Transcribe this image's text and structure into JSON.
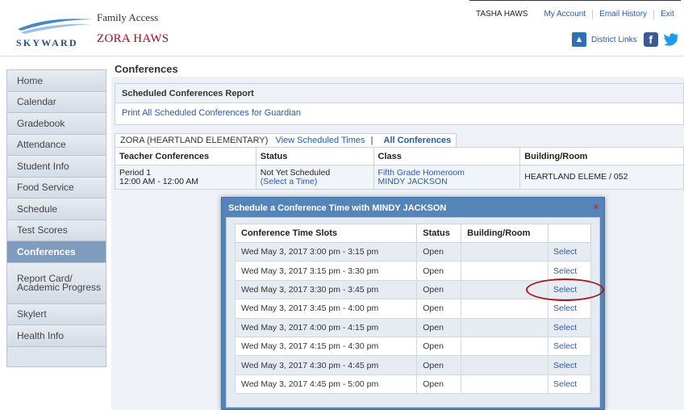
{
  "header": {
    "app_title": "Family Access",
    "logo_text": "SKYWARD",
    "student_name": "ZORA HAWS",
    "user_name": "TASHA HAWS",
    "my_account": "My Account",
    "email_history": "Email History",
    "exit": "Exit",
    "district_links": "District Links"
  },
  "sidebar": {
    "items": [
      {
        "label": "Home"
      },
      {
        "label": "Calendar"
      },
      {
        "label": "Gradebook"
      },
      {
        "label": "Attendance"
      },
      {
        "label": "Student Info"
      },
      {
        "label": "Food Service"
      },
      {
        "label": "Schedule"
      },
      {
        "label": "Test Scores"
      },
      {
        "label": "Conferences",
        "active": true
      },
      {
        "label": "Report Card/ Academic Progress"
      },
      {
        "label": "Skylert"
      },
      {
        "label": "Health Info"
      }
    ]
  },
  "main": {
    "page_title": "Conferences",
    "report_title": "Scheduled Conferences Report",
    "report_link": "Print All Scheduled Conferences for Guardian",
    "tabs": {
      "school": "ZORA (HEARTLAND ELEMENTARY)",
      "view_times": "View Scheduled Times",
      "separator": "|",
      "all_conferences": "All Conferences"
    },
    "table": {
      "headers": [
        "Teacher Conferences",
        "Status",
        "Class",
        "Building/Room"
      ],
      "row": {
        "period": "Period 1",
        "time": "12:00 AM - 12:00 AM",
        "status": "Not Yet Scheduled",
        "select_time": "(Select a Time)",
        "class_name": "Fifth Grade Homeroom",
        "teacher": "MINDY JACKSON",
        "building": "HEARTLAND ELEME / 052"
      }
    }
  },
  "modal": {
    "title": "Schedule a Conference Time with MINDY JACKSON",
    "close": "×",
    "headers": [
      "Conference Time Slots",
      "Status",
      "Building/Room",
      ""
    ],
    "slots": [
      {
        "time": "Wed May 3, 2017 3:00 pm - 3:15 pm",
        "status": "Open",
        "room": "",
        "action": "Select"
      },
      {
        "time": "Wed May 3, 2017 3:15 pm - 3:30 pm",
        "status": "Open",
        "room": "",
        "action": "Select"
      },
      {
        "time": "Wed May 3, 2017 3:30 pm - 3:45 pm",
        "status": "Open",
        "room": "",
        "action": "Select"
      },
      {
        "time": "Wed May 3, 2017 3:45 pm - 4:00 pm",
        "status": "Open",
        "room": "",
        "action": "Select"
      },
      {
        "time": "Wed May 3, 2017 4:00 pm - 4:15 pm",
        "status": "Open",
        "room": "",
        "action": "Select"
      },
      {
        "time": "Wed May 3, 2017 4:15 pm - 4:30 pm",
        "status": "Open",
        "room": "",
        "action": "Select"
      },
      {
        "time": "Wed May 3, 2017 4:30 pm - 4:45 pm",
        "status": "Open",
        "room": "",
        "action": "Select"
      },
      {
        "time": "Wed May 3, 2017 4:45 pm - 5:00 pm",
        "status": "Open",
        "room": "",
        "action": "Select"
      }
    ]
  },
  "colors": {
    "link": "#2a5aa7",
    "student_name": "#a30c1b",
    "modal_header": "#5585b8",
    "active_sidebar": "#7f9bbd",
    "highlight": "#a51c1c"
  }
}
